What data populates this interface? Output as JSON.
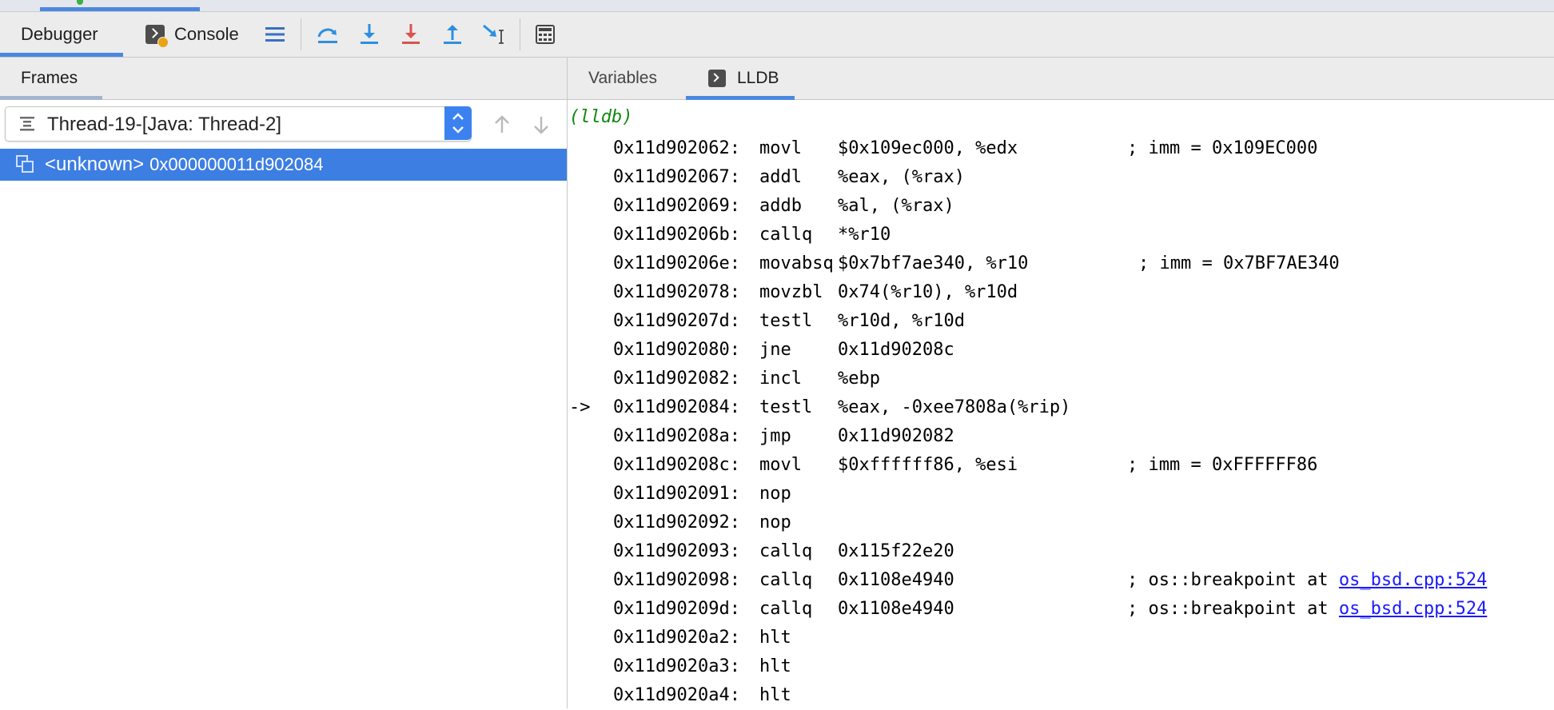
{
  "toolbar": {
    "debugger_tab": "Debugger",
    "console_tab": "Console",
    "buttons": [
      "view-breakpoints-icon",
      "step-over-icon",
      "step-into-icon",
      "force-step-into-icon",
      "step-out-icon",
      "run-to-cursor-icon",
      "evaluate-expression-icon"
    ],
    "accent": "#4a88e0"
  },
  "frames_panel": {
    "tab_label": "Frames",
    "thread_select": {
      "value": "Thread-19-[Java: Thread-2]"
    },
    "frames": [
      {
        "name": "<unknown>",
        "address": "0x000000011d902084",
        "selected": true
      }
    ],
    "selection_color": "#3d7ee3"
  },
  "right_panel": {
    "tabs": [
      {
        "label": "Variables",
        "active": false
      },
      {
        "label": "LLDB",
        "active": true
      }
    ]
  },
  "lldb": {
    "prompt": "(lldb)",
    "lines": [
      {
        "arrow": "",
        "address": "0x11d902062:",
        "mnemonic": "movl",
        "operands": "$0x109ec000, %edx",
        "comment": "; imm = 0x109EC000",
        "link": ""
      },
      {
        "arrow": "",
        "address": "0x11d902067:",
        "mnemonic": "addl",
        "operands": "%eax, (%rax)",
        "comment": "",
        "link": ""
      },
      {
        "arrow": "",
        "address": "0x11d902069:",
        "mnemonic": "addb",
        "operands": "%al, (%rax)",
        "comment": "",
        "link": ""
      },
      {
        "arrow": "",
        "address": "0x11d90206b:",
        "mnemonic": "callq",
        "operands": "*%r10",
        "comment": "",
        "link": ""
      },
      {
        "arrow": "",
        "address": "0x11d90206e:",
        "mnemonic": "movabsq",
        "operands": "$0x7bf7ae340, %r10",
        "comment": "; imm = 0x7BF7AE340",
        "link": ""
      },
      {
        "arrow": "",
        "address": "0x11d902078:",
        "mnemonic": "movzbl",
        "operands": "0x74(%r10), %r10d",
        "comment": "",
        "link": ""
      },
      {
        "arrow": "",
        "address": "0x11d90207d:",
        "mnemonic": "testl",
        "operands": "%r10d, %r10d",
        "comment": "",
        "link": ""
      },
      {
        "arrow": "",
        "address": "0x11d902080:",
        "mnemonic": "jne",
        "operands": "0x11d90208c",
        "comment": "",
        "link": ""
      },
      {
        "arrow": "",
        "address": "0x11d902082:",
        "mnemonic": "incl",
        "operands": "%ebp",
        "comment": "",
        "link": ""
      },
      {
        "arrow": "->",
        "address": "0x11d902084:",
        "mnemonic": "testl",
        "operands": "%eax, -0xee7808a(%rip)",
        "comment": "",
        "link": ""
      },
      {
        "arrow": "",
        "address": "0x11d90208a:",
        "mnemonic": "jmp",
        "operands": "0x11d902082",
        "comment": "",
        "link": ""
      },
      {
        "arrow": "",
        "address": "0x11d90208c:",
        "mnemonic": "movl",
        "operands": "$0xffffff86, %esi",
        "comment": "; imm = 0xFFFFFF86",
        "link": ""
      },
      {
        "arrow": "",
        "address": "0x11d902091:",
        "mnemonic": "nop",
        "operands": "",
        "comment": "",
        "link": ""
      },
      {
        "arrow": "",
        "address": "0x11d902092:",
        "mnemonic": "nop",
        "operands": "",
        "comment": "",
        "link": ""
      },
      {
        "arrow": "",
        "address": "0x11d902093:",
        "mnemonic": "callq",
        "operands": "0x115f22e20",
        "comment": "",
        "link": ""
      },
      {
        "arrow": "",
        "address": "0x11d902098:",
        "mnemonic": "callq",
        "operands": "0x1108e4940",
        "comment": "; os::breakpoint at ",
        "link": "os_bsd.cpp:524"
      },
      {
        "arrow": "",
        "address": "0x11d90209d:",
        "mnemonic": "callq",
        "operands": "0x1108e4940",
        "comment": "; os::breakpoint at ",
        "link": "os_bsd.cpp:524"
      },
      {
        "arrow": "",
        "address": "0x11d9020a2:",
        "mnemonic": "hlt",
        "operands": "",
        "comment": "",
        "link": ""
      },
      {
        "arrow": "",
        "address": "0x11d9020a3:",
        "mnemonic": "hlt",
        "operands": "",
        "comment": "",
        "link": ""
      },
      {
        "arrow": "",
        "address": "0x11d9020a4:",
        "mnemonic": "hlt",
        "operands": "",
        "comment": "",
        "link": ""
      }
    ]
  }
}
